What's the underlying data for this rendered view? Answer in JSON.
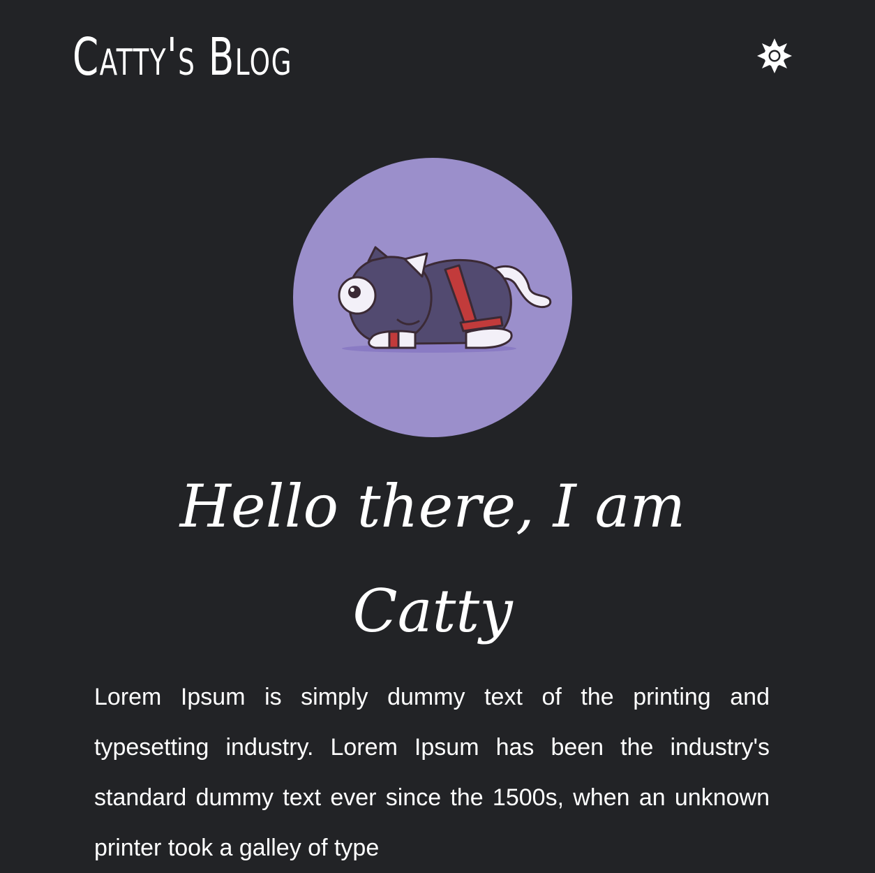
{
  "header": {
    "title": "Catty's Blog",
    "theme_toggle_icon": "sun-icon"
  },
  "hero": {
    "avatar_icon": "cat-illustration",
    "avatar_bg": "#9b8fcb",
    "greeting": "Hello there, I am Catty",
    "intro": "Lorem Ipsum is simply dummy text of the printing and typesetting industry. Lorem Ipsum has been the industry's standard dummy text ever since the 1500s, when an unknown printer took a galley of type"
  },
  "colors": {
    "background": "#222326",
    "text": "#ffffff"
  }
}
